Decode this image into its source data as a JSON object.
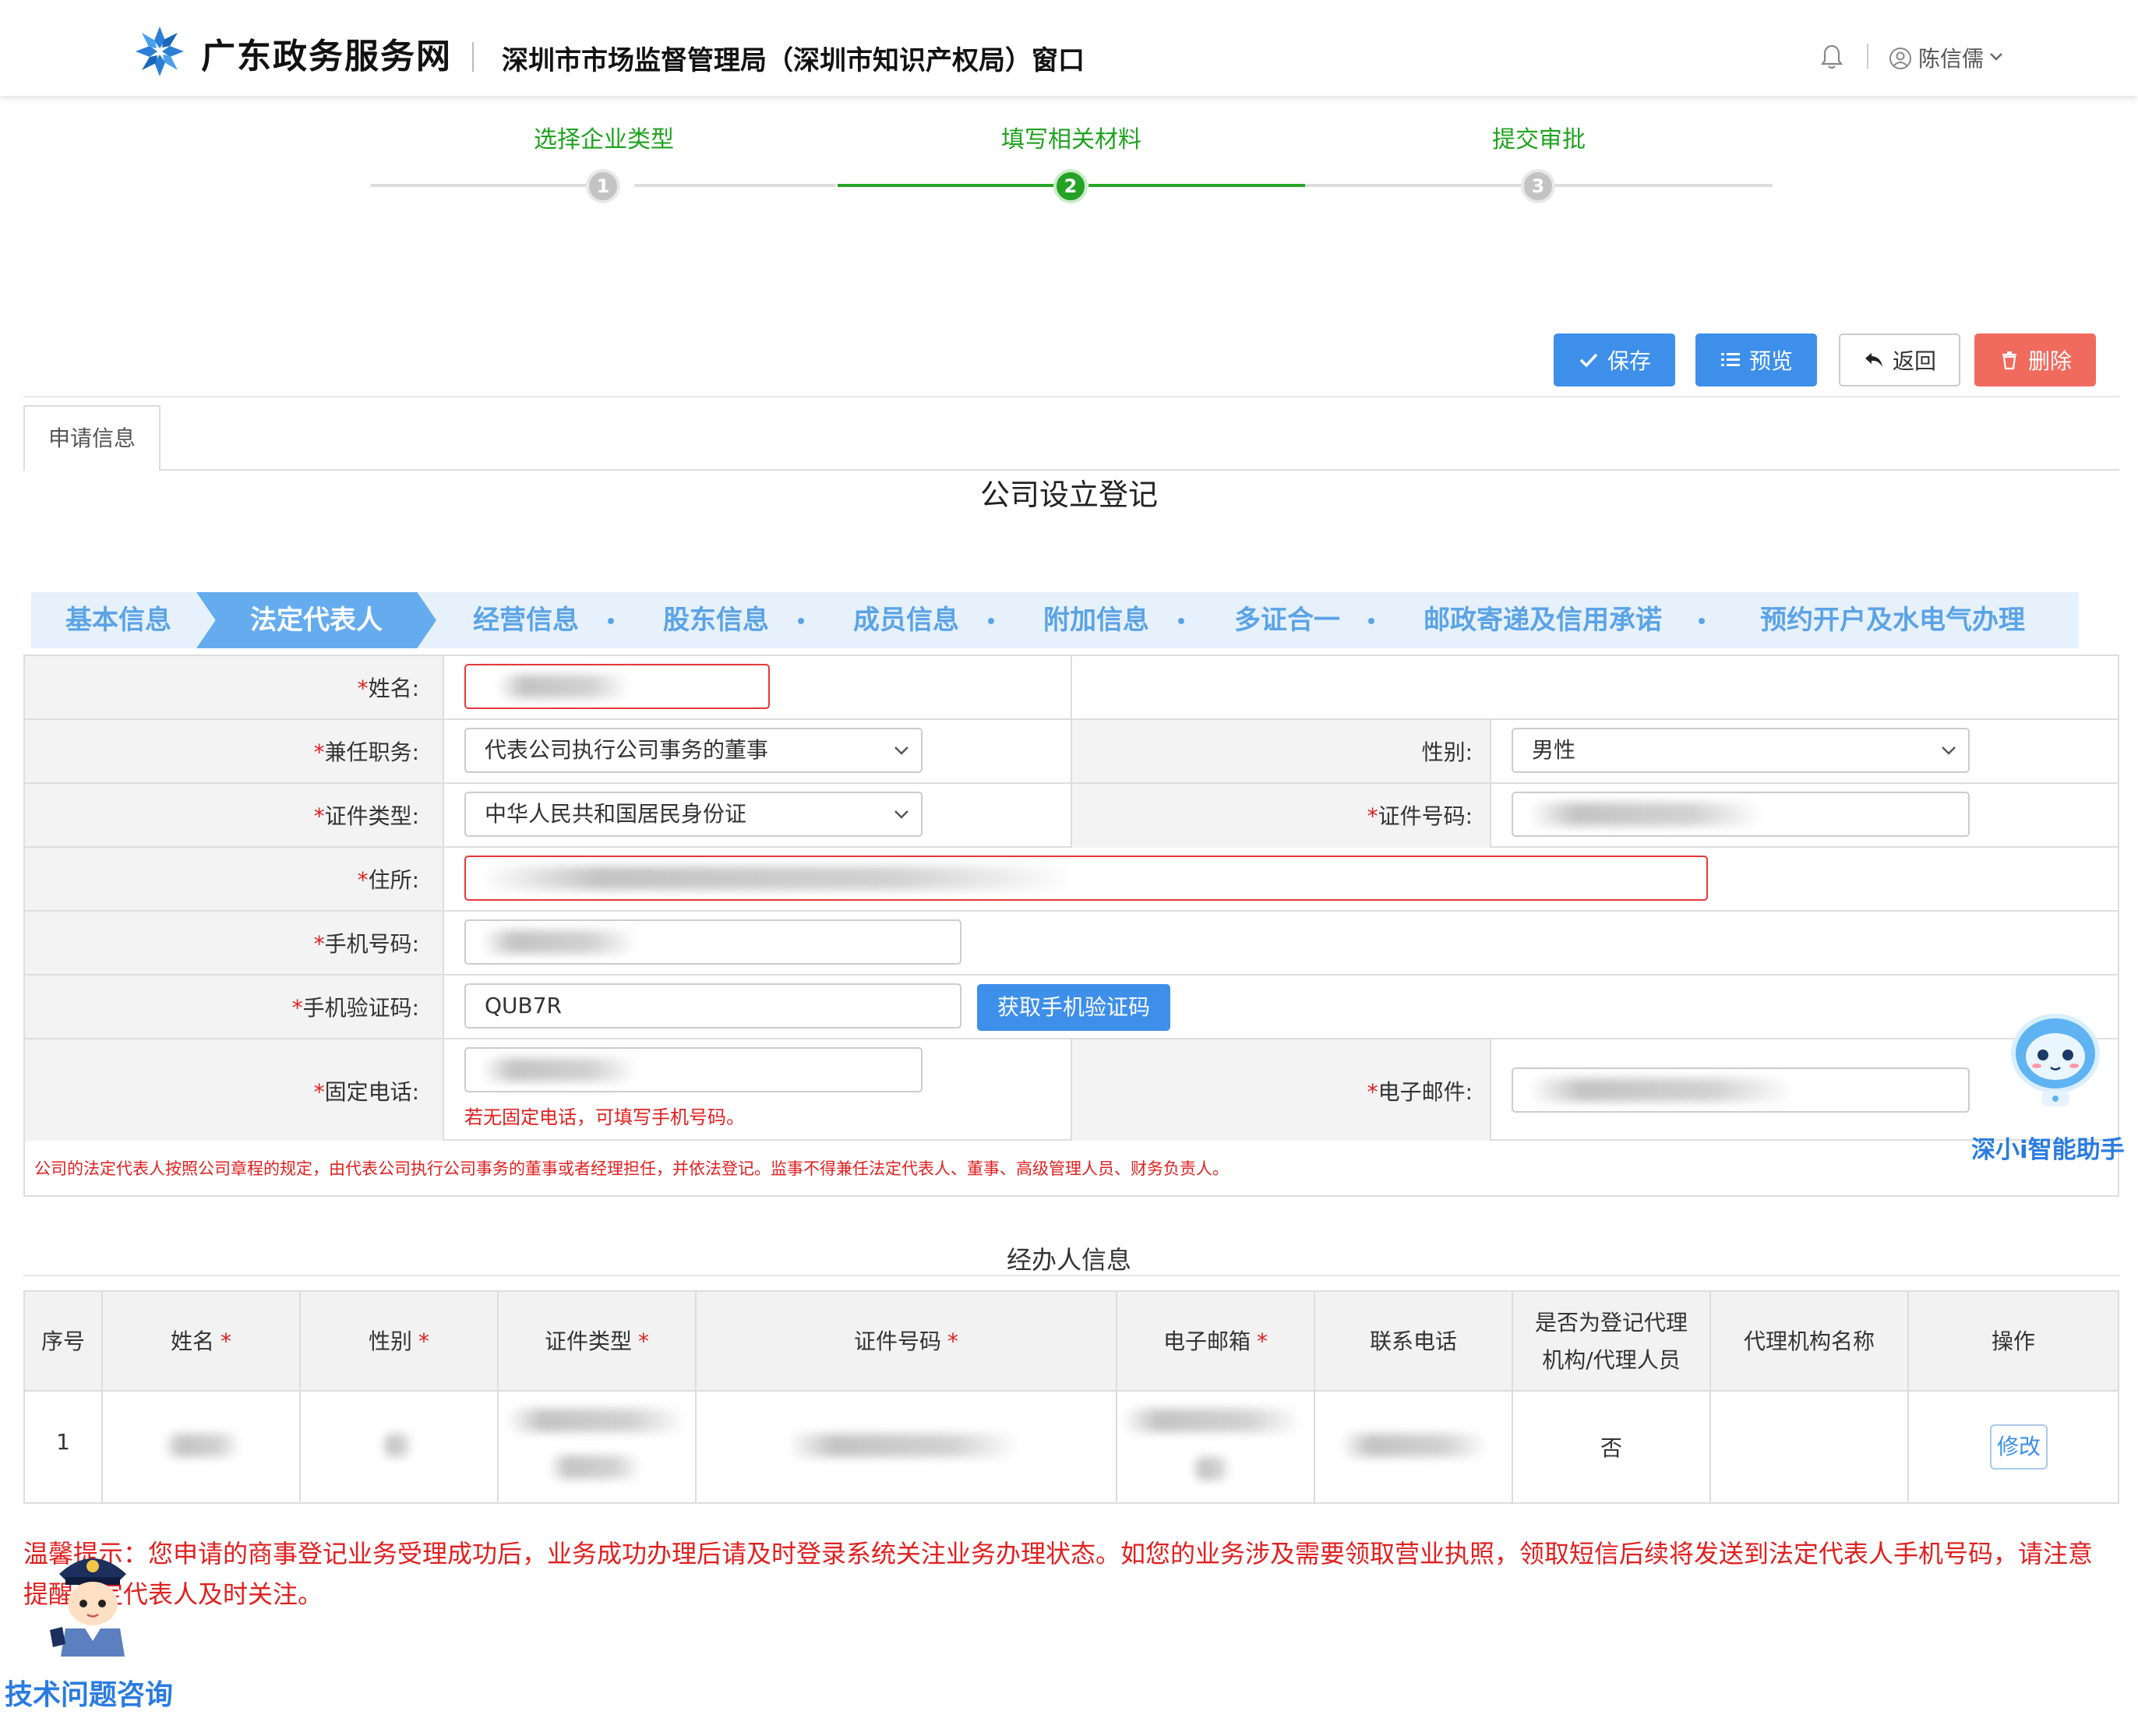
{
  "header": {
    "site_name": "广东政务服务网",
    "window_title": "深圳市市场监督管理局（深圳市知识产权局）窗口",
    "user_name": "陈信儒"
  },
  "steps": [
    {
      "label": "选择企业类型",
      "number": "1",
      "state": "done"
    },
    {
      "label": "填写相关材料",
      "number": "2",
      "state": "active"
    },
    {
      "label": "提交审批",
      "number": "3",
      "state": "pending"
    }
  ],
  "toolbar": {
    "save_label": "保存",
    "preview_label": "预览",
    "back_label": "返回",
    "delete_label": "删除"
  },
  "tab": {
    "label": "申请信息"
  },
  "form_title": "公司设立登记",
  "sections": [
    {
      "label": "基本信息"
    },
    {
      "label": "法定代表人"
    },
    {
      "label": "经营信息"
    },
    {
      "label": "股东信息"
    },
    {
      "label": "成员信息"
    },
    {
      "label": "附加信息"
    },
    {
      "label": "多证合一"
    },
    {
      "label": "邮政寄递及信用承诺"
    },
    {
      "label": "预约开户及水电气办理"
    }
  ],
  "form": {
    "name_label": "姓名:",
    "duty_label": "兼任职务:",
    "duty_value": "代表公司执行公司事务的董事",
    "gender_label": "性别:",
    "gender_value": "男性",
    "id_type_label": "证件类型:",
    "id_type_value": "中华人民共和国居民身份证",
    "id_number_label": "证件号码:",
    "address_label": "住所:",
    "mobile_label": "手机号码:",
    "sms_code_label": "手机验证码:",
    "sms_code_value": "QUB7R",
    "sms_button": "获取手机验证码",
    "landline_label": "固定电话:",
    "landline_hint": "若无固定电话，可填写手机号码。",
    "email_label": "电子邮件:",
    "note": "公司的法定代表人按照公司章程的规定，由代表公司执行公司事务的董事或者经理担任，并依法登记。监事不得兼任法定代表人、董事、高级管理人员、财务负责人。"
  },
  "agent": {
    "title": "经办人信息",
    "headers": {
      "seq": "序号",
      "name": "姓名",
      "gender": "性别",
      "id_type": "证件类型",
      "id_number": "证件号码",
      "email": "电子邮箱",
      "phone": "联系电话",
      "is_agent_line1": "是否为登记代理",
      "is_agent_line2": "机构/代理人员",
      "agency_name": "代理机构名称",
      "action": "操作"
    },
    "rows": [
      {
        "seq": "1",
        "is_agent": "否",
        "action": "修改"
      }
    ]
  },
  "notice": "温馨提示：您申请的商事登记业务受理成功后，业务成功办理后请及时登录系统关注业务办理状态。如您的业务涉及需要领取营业执照，领取短信后续将发送到法定代表人手机号码，请注意提醒法定代表人及时关注。",
  "widgets": {
    "assistant_label": "深小i智能助手",
    "support_label": "技术问题咨询"
  },
  "colors": {
    "primary": "#3d8fea",
    "danger": "#f16a5e",
    "step_green": "#25a125",
    "required": "#e02020"
  }
}
